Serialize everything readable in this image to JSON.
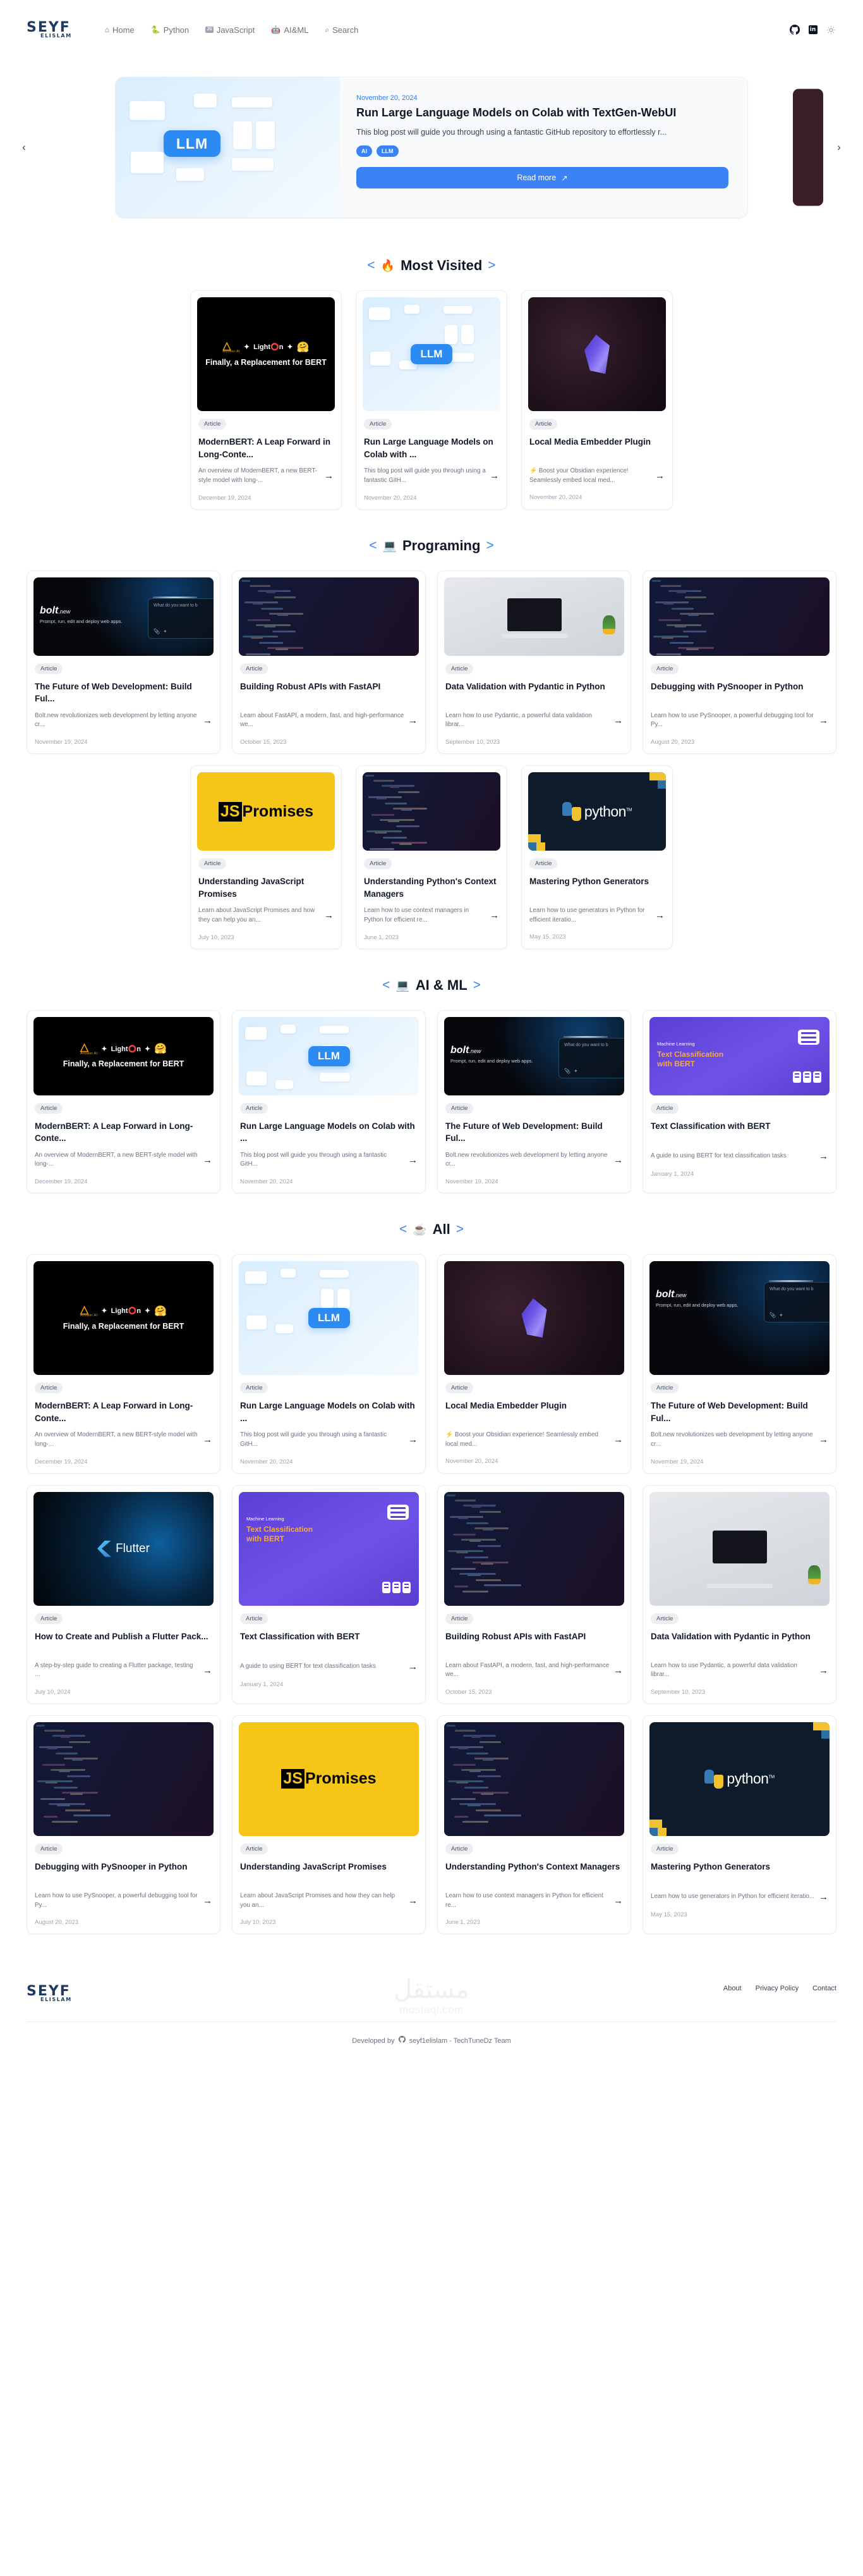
{
  "nav": {
    "brand_main": "SEYF",
    "brand_sub": "ELISLAM",
    "links": [
      {
        "label": "Home",
        "icon": "home-icon",
        "glyph": "⌂"
      },
      {
        "label": "Python",
        "icon": "python-icon",
        "glyph": "🐍"
      },
      {
        "label": "JavaScript",
        "icon": "javascript-icon",
        "glyph": "JS"
      },
      {
        "label": "AI&ML",
        "icon": "robot-icon",
        "glyph": "🤖"
      },
      {
        "label": "Search",
        "icon": "search-icon",
        "glyph": "⌕"
      }
    ],
    "github_label": "GitHub",
    "linkedin_label": "in",
    "theme_toggle_label": "☀"
  },
  "hero": {
    "prev_arrow": "‹",
    "next_arrow": "›",
    "date": "November 20, 2024",
    "title": "Run Large Language Models on Colab with TextGen-WebUI",
    "description": "This blog post will guide you through using a fantastic GitHub repository to effortlessly r...",
    "tags": [
      "AI",
      "LLM"
    ],
    "read_more": "Read more",
    "read_more_arrow": "↗",
    "thumb_label": "LLM"
  },
  "sections": [
    {
      "id": "most-visited",
      "icon": "fire-icon",
      "glyph": "🔥",
      "title": "Most Visited",
      "left_bracket": "<",
      "right_bracket": ">",
      "layout": "three-tall",
      "cards": [
        {
          "art": "bert",
          "pill": "Article",
          "title": "ModernBERT: A Leap Forward in Long-Conte...",
          "description": "An overview of ModernBERT, a new BERT-style model with long-...",
          "date": "December 19, 2024",
          "arrow": "→",
          "art_text": {
            "brand": "Answer.AI",
            "mid": "Light⭕n",
            "caption": "Finally, a Replacement for BERT"
          }
        },
        {
          "art": "llm",
          "pill": "Article",
          "title": "Run Large Language Models on Colab with ...",
          "description": "This blog post will guide you through using a fantastic GitH...",
          "date": "November 20, 2024",
          "arrow": "→",
          "art_text": {
            "chip": "LLM"
          }
        },
        {
          "art": "gem",
          "pill": "Article",
          "title": "Local Media Embedder Plugin",
          "description": "⚡ Boost your Obsidian experience! Seamlessly embed local med...",
          "date": "November 20, 2024",
          "arrow": "→",
          "art_text": {}
        }
      ]
    },
    {
      "id": "programing",
      "icon": "laptop-code-icon",
      "glyph": "💻",
      "title": "Programing",
      "left_bracket": "<",
      "right_bracket": ">",
      "layout": "four",
      "cards": [
        {
          "art": "bolt",
          "pill": "Article",
          "title": "The Future of Web Development: Build Ful...",
          "description": "Bolt.new revolutionizes web development by letting anyone cr...",
          "date": "November 19, 2024",
          "arrow": "→",
          "art_text": {
            "logo": "bolt",
            "logo_suffix": ".new",
            "sub": "Prompt, run, edit and deploy web apps.",
            "panel": "What do you want to b"
          }
        },
        {
          "art": "code",
          "pill": "Article",
          "title": "Building Robust APIs with FastAPI",
          "description": "Learn about FastAPI, a modern, fast, and high-performance we...",
          "date": "October 15, 2023",
          "arrow": "→",
          "art_text": {}
        },
        {
          "art": "laptop",
          "pill": "Article",
          "title": "Data Validation with Pydantic in Python",
          "description": "Learn how to use Pydantic, a powerful data validation librar...",
          "date": "September 10, 2023",
          "arrow": "→",
          "art_text": {}
        },
        {
          "art": "code",
          "pill": "Article",
          "title": "Debugging with PySnooper in Python",
          "description": "Learn how to use PySnooper, a powerful debugging tool for Py...",
          "date": "August 20, 2023",
          "arrow": "→",
          "art_text": {}
        }
      ],
      "cards_row2": [
        {
          "art": "jspromises",
          "pill": "Article",
          "title": "Understanding JavaScript Promises",
          "description": "Learn about JavaScript Promises and how they can help you an...",
          "date": "July 10, 2023",
          "arrow": "→",
          "art_text": {
            "js": "JS",
            "rest": "Promises"
          }
        },
        {
          "art": "code",
          "pill": "Article",
          "title": "Understanding Python's Context Managers",
          "description": "Learn how to use context managers in Python for efficient re...",
          "date": "June 1, 2023",
          "arrow": "→",
          "art_text": {}
        },
        {
          "art": "python",
          "pill": "Article",
          "title": "Mastering Python Generators",
          "description": "Learn how to use generators in Python for efficient iteratio...",
          "date": "May 15, 2023",
          "arrow": "→",
          "art_text": {
            "word": "python",
            "tm": "TM"
          }
        }
      ]
    },
    {
      "id": "ai-ml",
      "icon": "laptop-code-icon",
      "glyph": "💻",
      "title": "AI & ML",
      "left_bracket": "<",
      "right_bracket": ">",
      "layout": "four",
      "cards": [
        {
          "art": "bert",
          "pill": "Article",
          "title": "ModernBERT: A Leap Forward in Long-Conte...",
          "description": "An overview of ModernBERT, a new BERT-style model with long-...",
          "date": "December 19, 2024",
          "arrow": "→",
          "art_text": {
            "brand": "Answer.AI",
            "mid": "Light⭕n",
            "caption": "Finally, a Replacement for BERT"
          }
        },
        {
          "art": "llm",
          "pill": "Article",
          "title": "Run Large Language Models on Colab with ...",
          "description": "This blog post will guide you through using a fantastic GitH...",
          "date": "November 20, 2024",
          "arrow": "→",
          "art_text": {
            "chip": "LLM"
          }
        },
        {
          "art": "bolt",
          "pill": "Article",
          "title": "The Future of Web Development: Build Ful...",
          "description": "Bolt.new revolutionizes web development by letting anyone cr...",
          "date": "November 19, 2024",
          "arrow": "→",
          "art_text": {
            "logo": "bolt",
            "logo_suffix": ".new",
            "sub": "Prompt, run, edit and deploy web apps.",
            "panel": "What do you want to b"
          }
        },
        {
          "art": "textclass",
          "pill": "Article",
          "title": "Text Classification with BERT",
          "description": "A guide to using BERT for text classification tasks",
          "date": "January 1, 2024",
          "arrow": "→",
          "art_text": {
            "kicker": "Machine Learning",
            "title": "Text Classification with BERT"
          }
        }
      ]
    },
    {
      "id": "all",
      "icon": "coffee-icon",
      "glyph": "☕",
      "title": "All",
      "left_bracket": "<",
      "right_bracket": ">",
      "layout": "four-tall",
      "cards": [
        {
          "art": "bert",
          "pill": "Article",
          "title": "ModernBERT: A Leap Forward in Long-Conte...",
          "description": "An overview of ModernBERT, a new BERT-style model with long-...",
          "date": "December 19, 2024",
          "arrow": "→",
          "art_text": {
            "brand": "Answer.AI",
            "mid": "Light⭕n",
            "caption": "Finally, a Replacement for BERT"
          }
        },
        {
          "art": "llm",
          "pill": "Article",
          "title": "Run Large Language Models on Colab with ...",
          "description": "This blog post will guide you through using a fantastic GitH...",
          "date": "November 20, 2024",
          "arrow": "→",
          "art_text": {
            "chip": "LLM"
          }
        },
        {
          "art": "gem",
          "pill": "Article",
          "title": "Local Media Embedder Plugin",
          "description": "⚡ Boost your Obsidian experience! Seamlessly embed local med...",
          "date": "November 20, 2024",
          "arrow": "→",
          "art_text": {}
        },
        {
          "art": "bolt",
          "pill": "Article",
          "title": "The Future of Web Development: Build Ful...",
          "description": "Bolt.new revolutionizes web development by letting anyone cr...",
          "date": "November 19, 2024",
          "arrow": "→",
          "art_text": {
            "logo": "bolt",
            "logo_suffix": ".new",
            "sub": "Prompt, run, edit and deploy web apps.",
            "panel": "What do you want to b"
          }
        },
        {
          "art": "flutter",
          "pill": "Article",
          "title": "How to Create and Publish a Flutter Pack...",
          "description": "A step-by-step guide to creating a Flutter package, testing ...",
          "date": "July 10, 2024",
          "arrow": "→",
          "art_text": {
            "word": "Flutter"
          }
        },
        {
          "art": "textclass",
          "pill": "Article",
          "title": "Text Classification with BERT",
          "description": "A guide to using BERT for text classification tasks",
          "date": "January 1, 2024",
          "arrow": "→",
          "art_text": {
            "kicker": "Machine Learning",
            "title": "Text Classification with BERT"
          }
        },
        {
          "art": "code",
          "pill": "Article",
          "title": "Building Robust APIs with FastAPI",
          "description": "Learn about FastAPI, a modern, fast, and high-performance we...",
          "date": "October 15, 2023",
          "arrow": "→",
          "art_text": {}
        },
        {
          "art": "laptop",
          "pill": "Article",
          "title": "Data Validation with Pydantic in Python",
          "description": "Learn how to use Pydantic, a powerful data validation librar...",
          "date": "September 10, 2023",
          "arrow": "→",
          "art_text": {}
        },
        {
          "art": "code",
          "pill": "Article",
          "title": "Debugging with PySnooper in Python",
          "description": "Learn how to use PySnooper, a powerful debugging tool for Py...",
          "date": "August 20, 2023",
          "arrow": "→",
          "art_text": {}
        },
        {
          "art": "jspromises",
          "pill": "Article",
          "title": "Understanding JavaScript Promises",
          "description": "Learn about JavaScript Promises and how they can help you an...",
          "date": "July 10, 2023",
          "arrow": "→",
          "art_text": {
            "js": "JS",
            "rest": "Promises"
          }
        },
        {
          "art": "code",
          "pill": "Article",
          "title": "Understanding Python's Context Managers",
          "description": "Learn how to use context managers in Python for efficient re...",
          "date": "June 1, 2023",
          "arrow": "→",
          "art_text": {}
        },
        {
          "art": "python",
          "pill": "Article",
          "title": "Mastering Python Generators",
          "description": "Learn how to use generators in Python for efficient iteratio...",
          "date": "May 15, 2023",
          "arrow": "→",
          "art_text": {
            "word": "python",
            "tm": "TM"
          }
        }
      ]
    }
  ],
  "footer": {
    "brand_main": "SEYF",
    "brand_sub": "ELISLAM",
    "links": [
      "About",
      "Privacy Policy",
      "Contact"
    ],
    "watermark_ar": "مستقل",
    "watermark_domain": "mostaql.com",
    "credit_prefix": "Developed by",
    "credit_name": "seyf1elislam - TechTuneDz Team"
  },
  "colors": {
    "accent": "#3b82f6",
    "brand_navy": "#1e3a5f",
    "text": "#111827",
    "muted": "#6b7280",
    "pill_bg": "#eceef1"
  }
}
